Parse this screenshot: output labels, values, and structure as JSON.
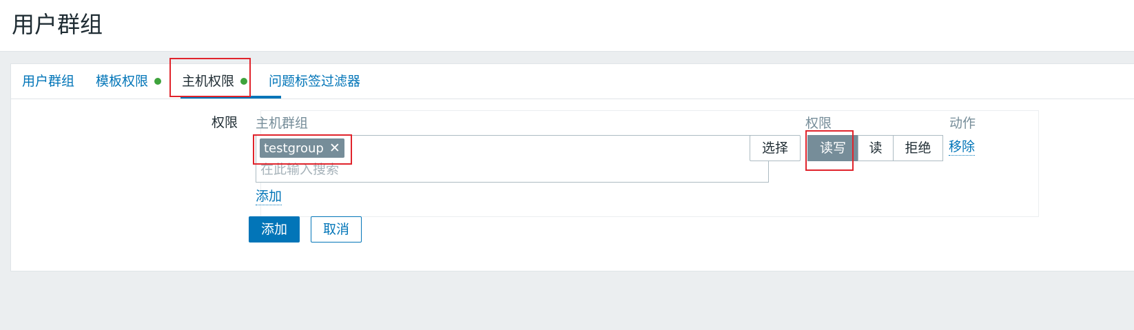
{
  "page": {
    "title": "用户群组"
  },
  "tabs": [
    {
      "label": "用户群组",
      "active": false,
      "has_dot": false
    },
    {
      "label": "模板权限",
      "active": false,
      "has_dot": true
    },
    {
      "label": "主机权限",
      "active": true,
      "has_dot": true
    },
    {
      "label": "问题标签过滤器",
      "active": false,
      "has_dot": false
    }
  ],
  "form": {
    "permissions_label": "权限",
    "columns": {
      "host_group": "主机群组",
      "permission": "权限",
      "action": "动作"
    },
    "host_group_field": {
      "selected": [
        "testgroup"
      ],
      "placeholder": "在此输入搜索"
    },
    "select_button": "选择",
    "permission_options": [
      "读写",
      "读",
      "拒绝"
    ],
    "permission_selected": "读写",
    "remove_link": "移除",
    "add_link": "添加"
  },
  "actions": {
    "add_button": "添加",
    "cancel_button": "取消"
  },
  "colors": {
    "accent": "#0275b8",
    "status_dot": "#3ea33c",
    "highlight": "#e0232b",
    "chip": "#768d99"
  },
  "icons": {
    "chip_remove": "close-icon",
    "tab_status": "status-dot-icon"
  }
}
